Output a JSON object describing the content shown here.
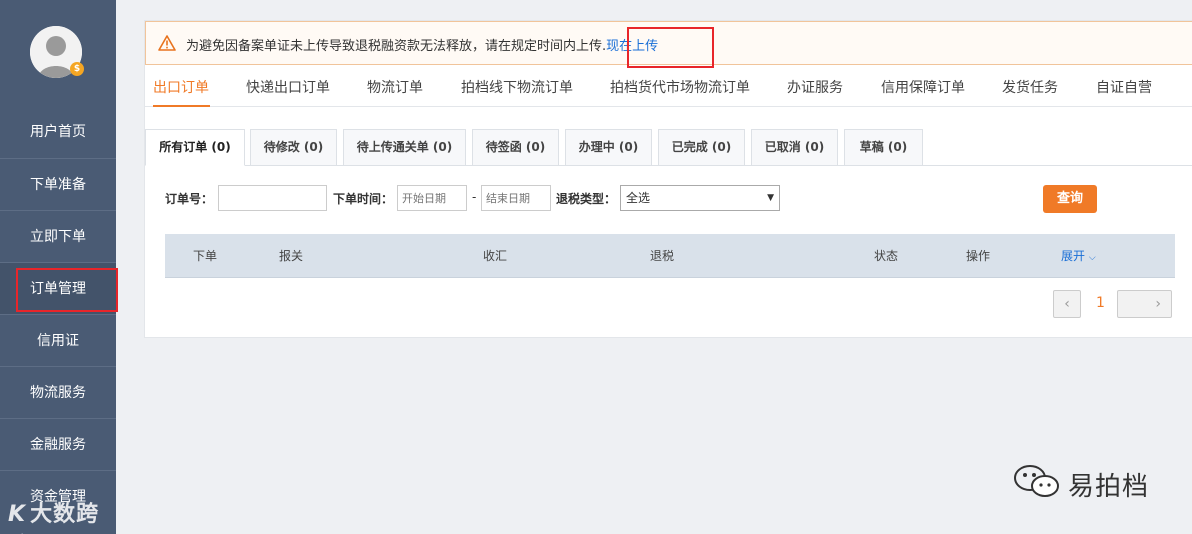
{
  "sidebar": {
    "items": [
      {
        "label": "用户首页"
      },
      {
        "label": "下单准备"
      },
      {
        "label": "立即下单"
      },
      {
        "label": "订单管理"
      },
      {
        "label": "信用证"
      },
      {
        "label": "物流服务"
      },
      {
        "label": "金融服务"
      },
      {
        "label": "资金管理"
      }
    ],
    "active_index": 3,
    "avatar_badge": "$"
  },
  "notice": {
    "text": "为避免因备案单证未上传导致退税融资款无法释放，请在规定时间内上传.",
    "link": "现在上传"
  },
  "tabs": [
    {
      "label": "出口订单",
      "active": true
    },
    {
      "label": "快递出口订单"
    },
    {
      "label": "物流订单"
    },
    {
      "label": "拍档线下物流订单"
    },
    {
      "label": "拍档货代市场物流订单"
    },
    {
      "label": "办证服务"
    },
    {
      "label": "信用保障订单"
    },
    {
      "label": "发货任务"
    },
    {
      "label": "自证自营"
    }
  ],
  "subtabs": [
    {
      "label": "所有订单 (0)",
      "active": true
    },
    {
      "label": "待修改 (0)"
    },
    {
      "label": "待上传通关单 (0)"
    },
    {
      "label": "待签函 (0)"
    },
    {
      "label": "办理中 (0)"
    },
    {
      "label": "已完成 (0)"
    },
    {
      "label": "已取消 (0)"
    },
    {
      "label": "草稿 (0)"
    }
  ],
  "filters": {
    "order_no_label": "订单号：",
    "order_no_value": "",
    "time_label": "下单时间：",
    "start_placeholder": "开始日期",
    "range_sep": "-",
    "end_placeholder": "结束日期",
    "refund_type_label": "退税类型：",
    "refund_type_value": "全选",
    "query_label": "查询"
  },
  "table": {
    "columns": [
      "下单",
      "报关",
      "收汇",
      "退税",
      "状态",
      "操作"
    ],
    "expand_label": "展开"
  },
  "pager": {
    "prev": "‹",
    "current": "1",
    "next": "›"
  },
  "watermarks": {
    "left": "大数跨境",
    "right": "易拍档"
  },
  "colors": {
    "accent": "#f07a27",
    "sidebar": "#4a5b74",
    "link": "#1a6fd6",
    "highlight": "#e8252a"
  }
}
